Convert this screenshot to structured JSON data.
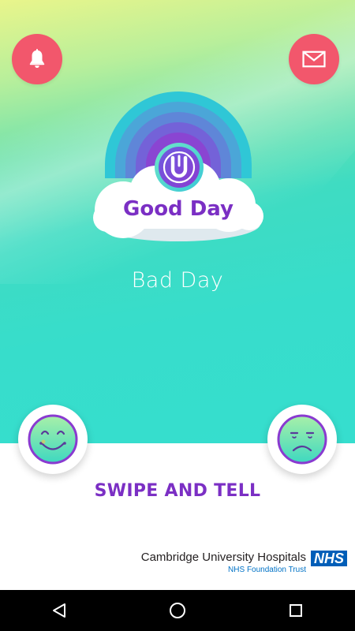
{
  "header": {
    "notifications_icon": "bell-icon",
    "messages_icon": "mail-icon",
    "accent_color": "#f2576c"
  },
  "mood": {
    "current_label": "Good Day",
    "alternate_label": "Bad Day"
  },
  "actions": {
    "happy_icon": "smiley-face-icon",
    "sad_icon": "sad-face-icon",
    "prompt": "SWIPE AND TELL",
    "prompt_color": "#7b2fc4"
  },
  "footer": {
    "org_name": "Cambridge University Hospitals",
    "org_sub": "NHS Foundation Trust",
    "badge": "NHS"
  },
  "navbar": {
    "back_icon": "back-triangle-icon",
    "home_icon": "home-circle-icon",
    "recents_icon": "recents-square-icon"
  }
}
